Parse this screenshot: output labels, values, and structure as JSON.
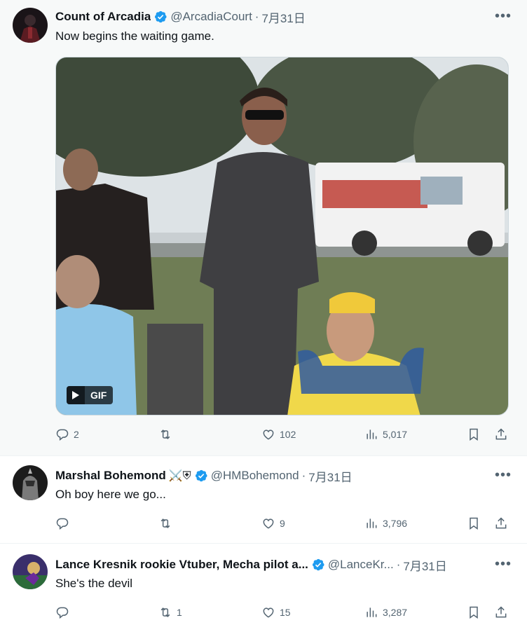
{
  "tweets": [
    {
      "name": "Count of Arcadia",
      "handle": "@ArcadiaCourt",
      "date": "7月31日",
      "text": "Now begins the waiting game.",
      "media_badge": "GIF",
      "actions": {
        "replies": "2",
        "retweets": "",
        "likes": "102",
        "views": "5,017"
      }
    },
    {
      "name": "Marshal Bohemond",
      "emoji": "⚔️⛨",
      "handle": "@HMBohemond",
      "date": "7月31日",
      "text": "Oh boy here we go...",
      "actions": {
        "replies": "",
        "retweets": "",
        "likes": "9",
        "views": "3,796"
      }
    },
    {
      "name": "Lance Kresnik rookie Vtuber, Mecha pilot a...",
      "handle": "@LanceKr...",
      "date": "7月31日",
      "text": "She's the devil",
      "actions": {
        "replies": "",
        "retweets": "1",
        "likes": "15",
        "views": "3,287"
      }
    }
  ],
  "colors": {
    "verified": "#1d9bf0",
    "muted": "#536471",
    "text": "#0f1419"
  },
  "icons": [
    "reply-icon",
    "retweet-icon",
    "like-icon",
    "views-icon",
    "bookmark-icon",
    "share-icon",
    "more-icon",
    "verified-badge-icon",
    "play-icon"
  ]
}
